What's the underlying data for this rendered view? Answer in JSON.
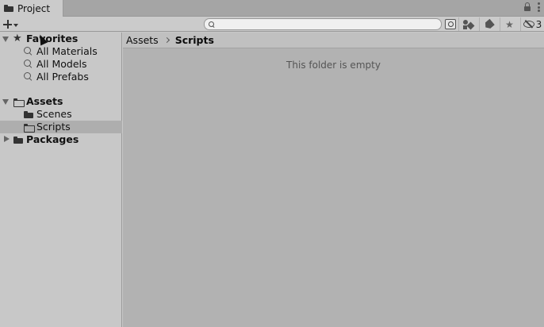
{
  "window": {
    "tab_title": "Project",
    "hidden_count": "3"
  },
  "toolbar": {
    "search_value": "",
    "search_placeholder": ""
  },
  "tree": {
    "favorites": {
      "label": "Favorites",
      "items": [
        "All Materials",
        "All Models",
        "All Prefabs"
      ]
    },
    "assets": {
      "label": "Assets",
      "items": [
        "Scenes",
        "Scripts"
      ]
    },
    "packages": {
      "label": "Packages"
    }
  },
  "breadcrumb": {
    "root": "Assets",
    "current": "Scripts"
  },
  "content": {
    "empty_message": "This folder is empty"
  }
}
